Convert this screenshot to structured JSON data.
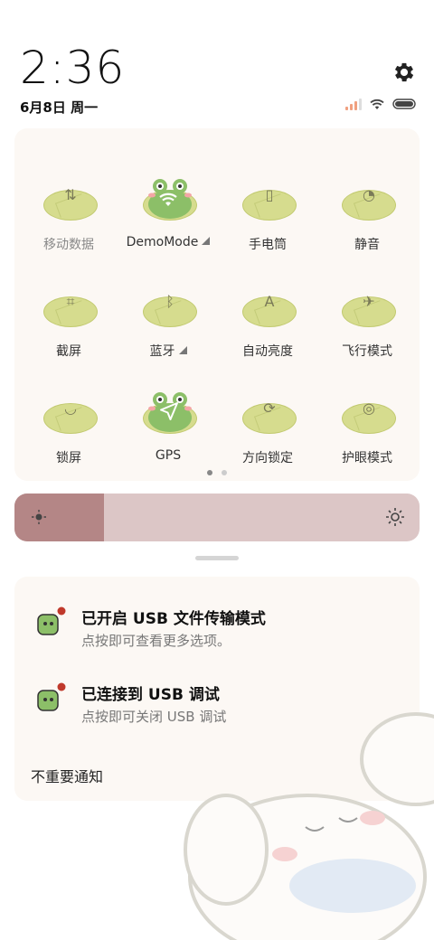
{
  "status_bar": {
    "time": "2:36",
    "date": "6月8日 周一",
    "icons": [
      "signal-icon",
      "wifi-icon",
      "battery-icon"
    ]
  },
  "quick_settings": {
    "tiles": [
      {
        "label": "移动数据",
        "icon": "mobile-data-icon",
        "active": false,
        "has_menu": false
      },
      {
        "label": "DemoMode",
        "icon": "wifi-icon",
        "active": true,
        "has_menu": true
      },
      {
        "label": "手电筒",
        "icon": "flashlight-icon",
        "active": false,
        "has_menu": false
      },
      {
        "label": "静音",
        "icon": "bell-icon",
        "active": false,
        "has_menu": false
      },
      {
        "label": "截屏",
        "icon": "screenshot-icon",
        "active": false,
        "has_menu": false
      },
      {
        "label": "蓝牙",
        "icon": "bluetooth-icon",
        "active": false,
        "has_menu": true
      },
      {
        "label": "自动亮度",
        "icon": "auto-brightness-icon",
        "active": false,
        "has_menu": false
      },
      {
        "label": "飞行模式",
        "icon": "airplane-icon",
        "active": false,
        "has_menu": false
      },
      {
        "label": "锁屏",
        "icon": "lock-icon",
        "active": false,
        "has_menu": false
      },
      {
        "label": "GPS",
        "icon": "location-arrow-icon",
        "active": true,
        "has_menu": false
      },
      {
        "label": "方向锁定",
        "icon": "rotation-lock-icon",
        "active": false,
        "has_menu": false
      },
      {
        "label": "护眼模式",
        "icon": "eye-icon",
        "active": false,
        "has_menu": false
      }
    ],
    "page_count": 2,
    "current_page": 1
  },
  "brightness": {
    "level": 0.22,
    "fill_color": "#b48686",
    "track_color": "#dcc6c6"
  },
  "notifications": {
    "items": [
      {
        "title": "已开启 USB 文件传输模式",
        "subtitle": "点按即可查看更多选项。",
        "icon": "android-usb-icon"
      },
      {
        "title": "已连接到 USB 调试",
        "subtitle": "点按即可关闭 USB 调试",
        "icon": "android-usb-icon"
      }
    ],
    "unimportant_label": "不重要通知"
  },
  "colors": {
    "pad": "#d6dc8e",
    "frog": "#8cbf68",
    "panel": "#fcf8f4"
  }
}
